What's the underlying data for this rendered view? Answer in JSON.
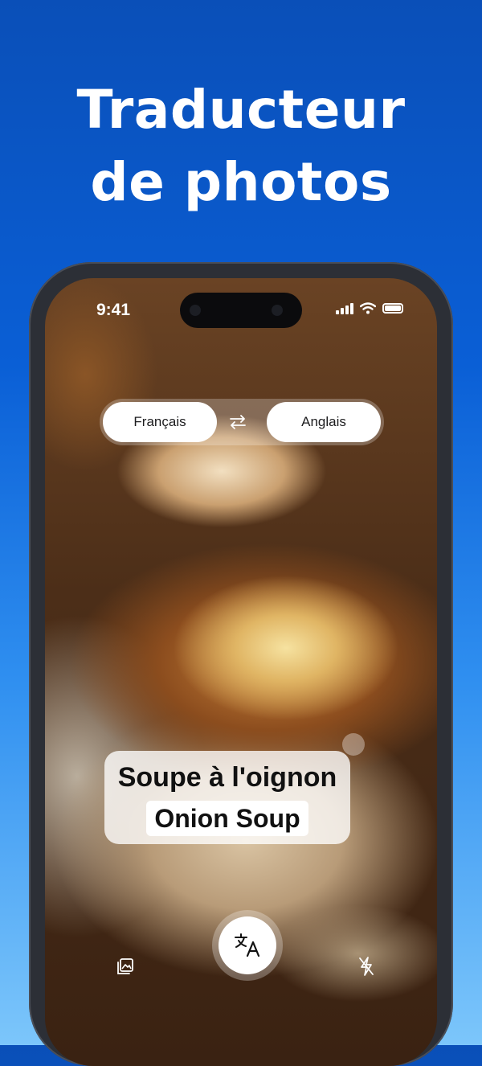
{
  "headline": {
    "line1": "Traducteur",
    "line2": "de photos"
  },
  "status_bar": {
    "time": "9:41"
  },
  "languages": {
    "source": "Français",
    "target": "Anglais"
  },
  "translation": {
    "source_text": "Soupe à l'oignon",
    "target_text": "Onion Soup"
  },
  "colors": {
    "background_top": "#0a4fb8",
    "background_bottom": "#7cc6fb",
    "pill": "#ffffff"
  },
  "icons": {
    "swap": "swap-arrows-icon",
    "gallery": "gallery-icon",
    "translate": "translate-icon",
    "flash_off": "flash-off-icon"
  }
}
